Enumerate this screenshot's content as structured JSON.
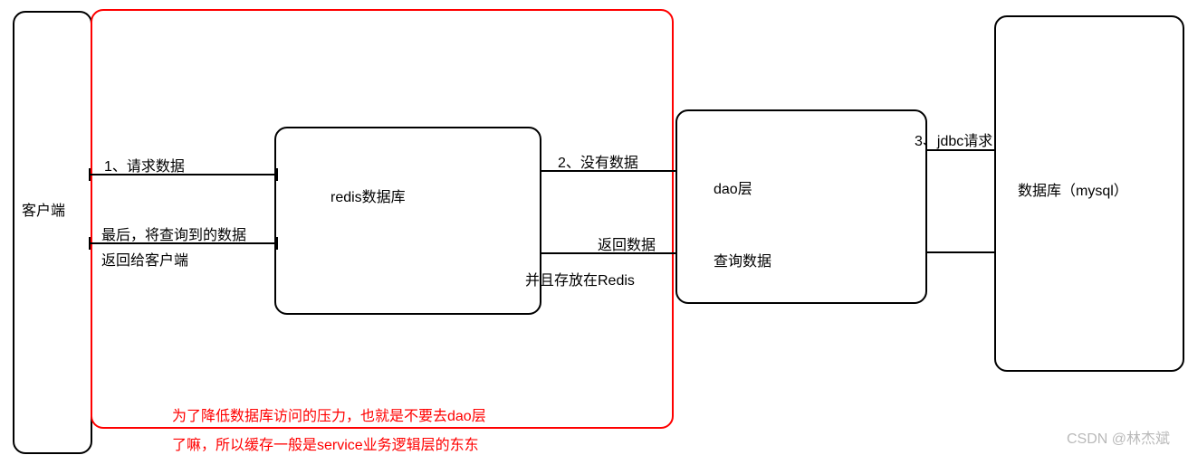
{
  "nodes": {
    "client": "客户端",
    "redis": "redis数据库",
    "dao": "dao层",
    "dao_sub": "查询数据",
    "mysql": "数据库（mysql）"
  },
  "edges": {
    "e1": "1、请求数据",
    "e2": "2、没有数据",
    "e3": "3、jdbc请求",
    "return_client_a": "最后，将查询到的数据",
    "return_client_b": "返回给客户端",
    "return_data_a": "返回数据",
    "return_data_b": "并且存放在Redis"
  },
  "note": {
    "line1": "为了降低数据库访问的压力，也就是不要去dao层",
    "line2": "了嘛，所以缓存一般是service业务逻辑层的东东"
  },
  "watermark": "CSDN @林杰斌"
}
